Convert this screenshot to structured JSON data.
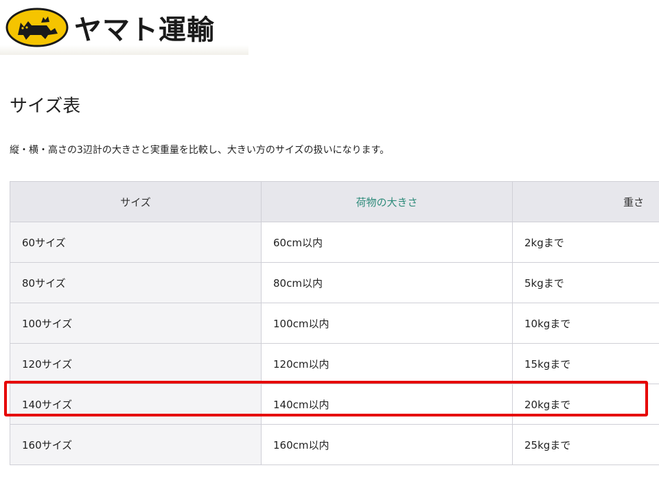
{
  "logo": {
    "text": "ヤマト運輸",
    "mark_icon": "black-cat-logo-icon",
    "mark_color": "#f5c400"
  },
  "page_title": "サイズ表",
  "description": "縦・横・高さの3辺計の大きさと実重量を比較し、大きい方のサイズの扱いになります。",
  "table": {
    "headers": {
      "size": "サイズ",
      "dimensions": "荷物の大きさ",
      "weight": "重さ"
    },
    "rows": [
      {
        "size": "60サイズ",
        "dimensions": "60cm以内",
        "weight": "2kgまで"
      },
      {
        "size": "80サイズ",
        "dimensions": "80cm以内",
        "weight": "5kgまで"
      },
      {
        "size": "100サイズ",
        "dimensions": "100cm以内",
        "weight": "10kgまで"
      },
      {
        "size": "120サイズ",
        "dimensions": "120cm以内",
        "weight": "15kgまで"
      },
      {
        "size": "140サイズ",
        "dimensions": "140cm以内",
        "weight": "20kgまで"
      },
      {
        "size": "160サイズ",
        "dimensions": "160cm以内",
        "weight": "25kgまで"
      }
    ],
    "highlighted_row": "140サイズ",
    "highlight_color": "#e60000",
    "header_accent_color": "#2e8b7a"
  }
}
